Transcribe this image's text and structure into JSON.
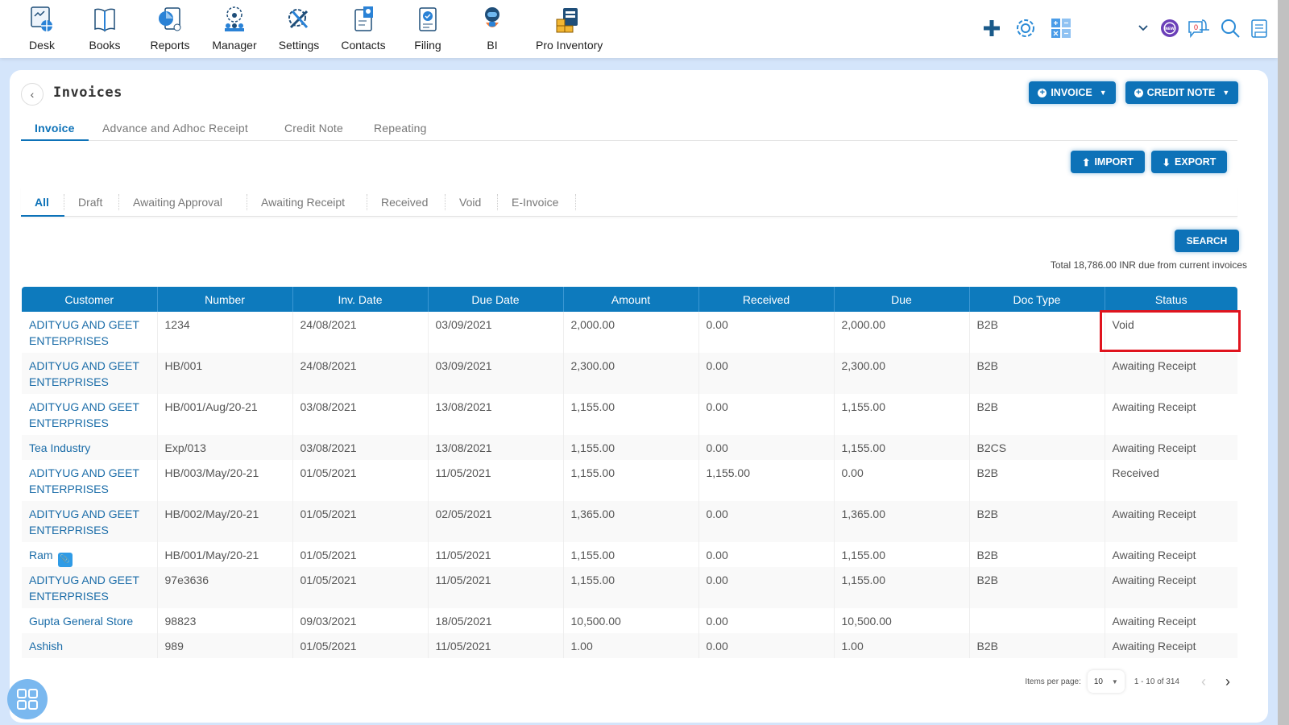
{
  "nav": {
    "items": [
      {
        "label": "Desk",
        "icon": "desk-icon"
      },
      {
        "label": "Books",
        "icon": "books-icon"
      },
      {
        "label": "Reports",
        "icon": "reports-icon"
      },
      {
        "label": "Manager",
        "icon": "manager-icon"
      },
      {
        "label": "Settings",
        "icon": "settings-tools-icon"
      },
      {
        "label": "Contacts",
        "icon": "contacts-icon"
      },
      {
        "label": "Filing",
        "icon": "filing-icon"
      },
      {
        "label": "BI",
        "icon": "bi-robot-icon"
      },
      {
        "label": "Pro Inventory",
        "icon": "pro-inventory-icon"
      }
    ],
    "right_icons": [
      "plus-icon",
      "gear-icon",
      "calculator-icon",
      "chevron-down-icon",
      "new-badge-icon",
      "notification-icon",
      "search-icon",
      "clipboard-icon"
    ],
    "notification_count": "0",
    "new_badge_text": "NEW"
  },
  "page": {
    "title": "Invoices",
    "invoice_button": "INVOICE",
    "credit_note_button": "CREDIT NOTE",
    "import_button": "IMPORT",
    "export_button": "EXPORT",
    "search_button": "SEARCH",
    "total_text": "Total 18,786.00 INR due from current invoices"
  },
  "tabs": [
    {
      "label": "Invoice",
      "active": true
    },
    {
      "label": "Advance and Adhoc Receipt"
    },
    {
      "label": "Credit Note"
    },
    {
      "label": "Repeating"
    }
  ],
  "subtabs": [
    {
      "label": "All",
      "active": true
    },
    {
      "label": "Draft"
    },
    {
      "label": "Awaiting Approval"
    },
    {
      "label": "Awaiting Receipt"
    },
    {
      "label": "Received"
    },
    {
      "label": "Void"
    },
    {
      "label": "E-Invoice"
    }
  ],
  "table": {
    "columns": [
      "Customer",
      "Number",
      "Inv. Date",
      "Due Date",
      "Amount",
      "Received",
      "Due",
      "Doc Type",
      "Status"
    ],
    "rows": [
      {
        "customer": "ADITYUG AND GEET ENTERPRISES",
        "number": "1234",
        "inv_date": "24/08/2021",
        "due_date": "03/09/2021",
        "amount": "2,000.00",
        "received": "0.00",
        "due": "2,000.00",
        "doc_type": "B2B",
        "status": "Void"
      },
      {
        "customer": "ADITYUG AND GEET ENTERPRISES",
        "number": "HB/001",
        "inv_date": "24/08/2021",
        "due_date": "03/09/2021",
        "amount": "2,300.00",
        "received": "0.00",
        "due": "2,300.00",
        "doc_type": "B2B",
        "status": "Awaiting Receipt"
      },
      {
        "customer": "ADITYUG AND GEET ENTERPRISES",
        "number": "HB/001/Aug/20-21",
        "inv_date": "03/08/2021",
        "due_date": "13/08/2021",
        "amount": "1,155.00",
        "received": "0.00",
        "due": "1,155.00",
        "doc_type": "B2B",
        "status": "Awaiting Receipt"
      },
      {
        "customer": "Tea Industry",
        "number": "Exp/013",
        "inv_date": "03/08/2021",
        "due_date": "13/08/2021",
        "amount": "1,155.00",
        "received": "0.00",
        "due": "1,155.00",
        "doc_type": "B2CS",
        "status": "Awaiting Receipt"
      },
      {
        "customer": "ADITYUG AND GEET ENTERPRISES",
        "number": "HB/003/May/20-21",
        "inv_date": "01/05/2021",
        "due_date": "11/05/2021",
        "amount": "1,155.00",
        "received": "1,155.00",
        "due": "0.00",
        "doc_type": "B2B",
        "status": "Received"
      },
      {
        "customer": "ADITYUG AND GEET ENTERPRISES",
        "number": "HB/002/May/20-21",
        "inv_date": "01/05/2021",
        "due_date": "02/05/2021",
        "amount": "1,365.00",
        "received": "0.00",
        "due": "1,365.00",
        "doc_type": "B2B",
        "status": "Awaiting Receipt"
      },
      {
        "customer": "Ram",
        "attachment": true,
        "number": "HB/001/May/20-21",
        "inv_date": "01/05/2021",
        "due_date": "11/05/2021",
        "amount": "1,155.00",
        "received": "0.00",
        "due": "1,155.00",
        "doc_type": "B2B",
        "status": "Awaiting Receipt"
      },
      {
        "customer": "ADITYUG AND GEET ENTERPRISES",
        "number": "97e3636",
        "inv_date": "01/05/2021",
        "due_date": "11/05/2021",
        "amount": "1,155.00",
        "received": "0.00",
        "due": "1,155.00",
        "doc_type": "B2B",
        "status": "Awaiting Receipt"
      },
      {
        "customer": "Gupta General Store",
        "number": "98823",
        "inv_date": "09/03/2021",
        "due_date": "18/05/2021",
        "amount": "10,500.00",
        "received": "0.00",
        "due": "10,500.00",
        "doc_type": "",
        "status": "Awaiting Receipt"
      },
      {
        "customer": "Ashish",
        "number": "989",
        "inv_date": "01/05/2021",
        "due_date": "11/05/2021",
        "amount": "1.00",
        "received": "0.00",
        "due": "1.00",
        "doc_type": "B2B",
        "status": "Awaiting Receipt"
      }
    ]
  },
  "pagination": {
    "items_per_page_label": "Items per page:",
    "items_per_page": "10",
    "range": "1 - 10 of 314"
  },
  "colors": {
    "primary": "#0d72b8",
    "header": "#0d7abd",
    "link": "#1a6ca8",
    "highlight": "#e0141e"
  }
}
